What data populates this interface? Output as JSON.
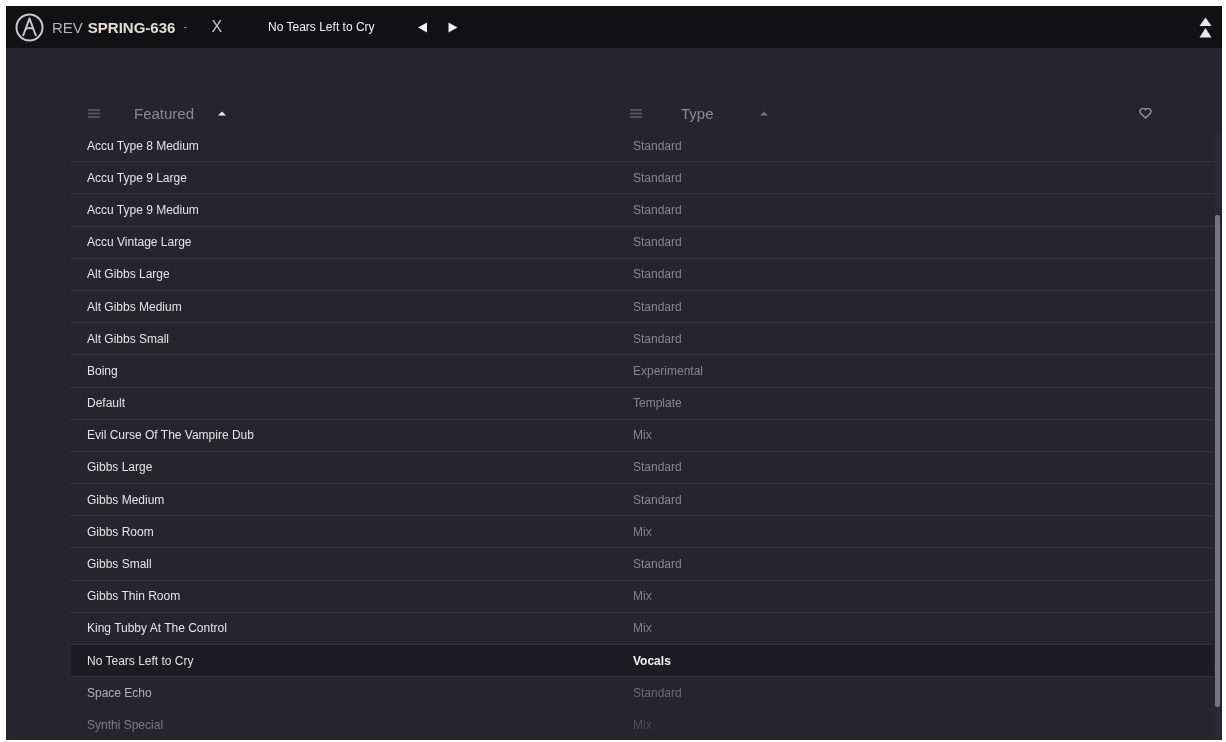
{
  "top_bar": {
    "brand": "REV",
    "product": "SPRING-636",
    "menu_mark": "-",
    "close": "X",
    "preset_name": "No Tears Left to Cry"
  },
  "browser": {
    "columns": [
      {
        "label": "Featured",
        "ascending": true,
        "sort_active": true
      },
      {
        "label": "Type",
        "ascending": true,
        "sort_active": false
      }
    ],
    "rows": [
      {
        "name": "Accu Type 8 Medium",
        "type": "Standard",
        "selected": false
      },
      {
        "name": "Accu Type 9 Large",
        "type": "Standard",
        "selected": false
      },
      {
        "name": "Accu Type 9 Medium",
        "type": "Standard",
        "selected": false
      },
      {
        "name": "Accu Vintage Large",
        "type": "Standard",
        "selected": false
      },
      {
        "name": "Alt Gibbs Large",
        "type": "Standard",
        "selected": false
      },
      {
        "name": "Alt Gibbs Medium",
        "type": "Standard",
        "selected": false
      },
      {
        "name": "Alt Gibbs Small",
        "type": "Standard",
        "selected": false
      },
      {
        "name": "Boing",
        "type": "Experimental",
        "selected": false
      },
      {
        "name": "Default",
        "type": "Template",
        "selected": false
      },
      {
        "name": "Evil Curse Of The Vampire Dub",
        "type": "Mix",
        "selected": false
      },
      {
        "name": "Gibbs Large",
        "type": "Standard",
        "selected": false
      },
      {
        "name": "Gibbs Medium",
        "type": "Standard",
        "selected": false
      },
      {
        "name": "Gibbs Room",
        "type": "Mix",
        "selected": false
      },
      {
        "name": "Gibbs Small",
        "type": "Standard",
        "selected": false
      },
      {
        "name": "Gibbs Thin Room",
        "type": "Mix",
        "selected": false
      },
      {
        "name": "King Tubby At The Control",
        "type": "Mix",
        "selected": false
      },
      {
        "name": "No Tears Left to Cry",
        "type": "Vocals",
        "selected": true
      },
      {
        "name": "Space Echo",
        "type": "Standard",
        "selected": false
      },
      {
        "name": "Synthi Special",
        "type": "Mix",
        "selected": false
      }
    ]
  }
}
